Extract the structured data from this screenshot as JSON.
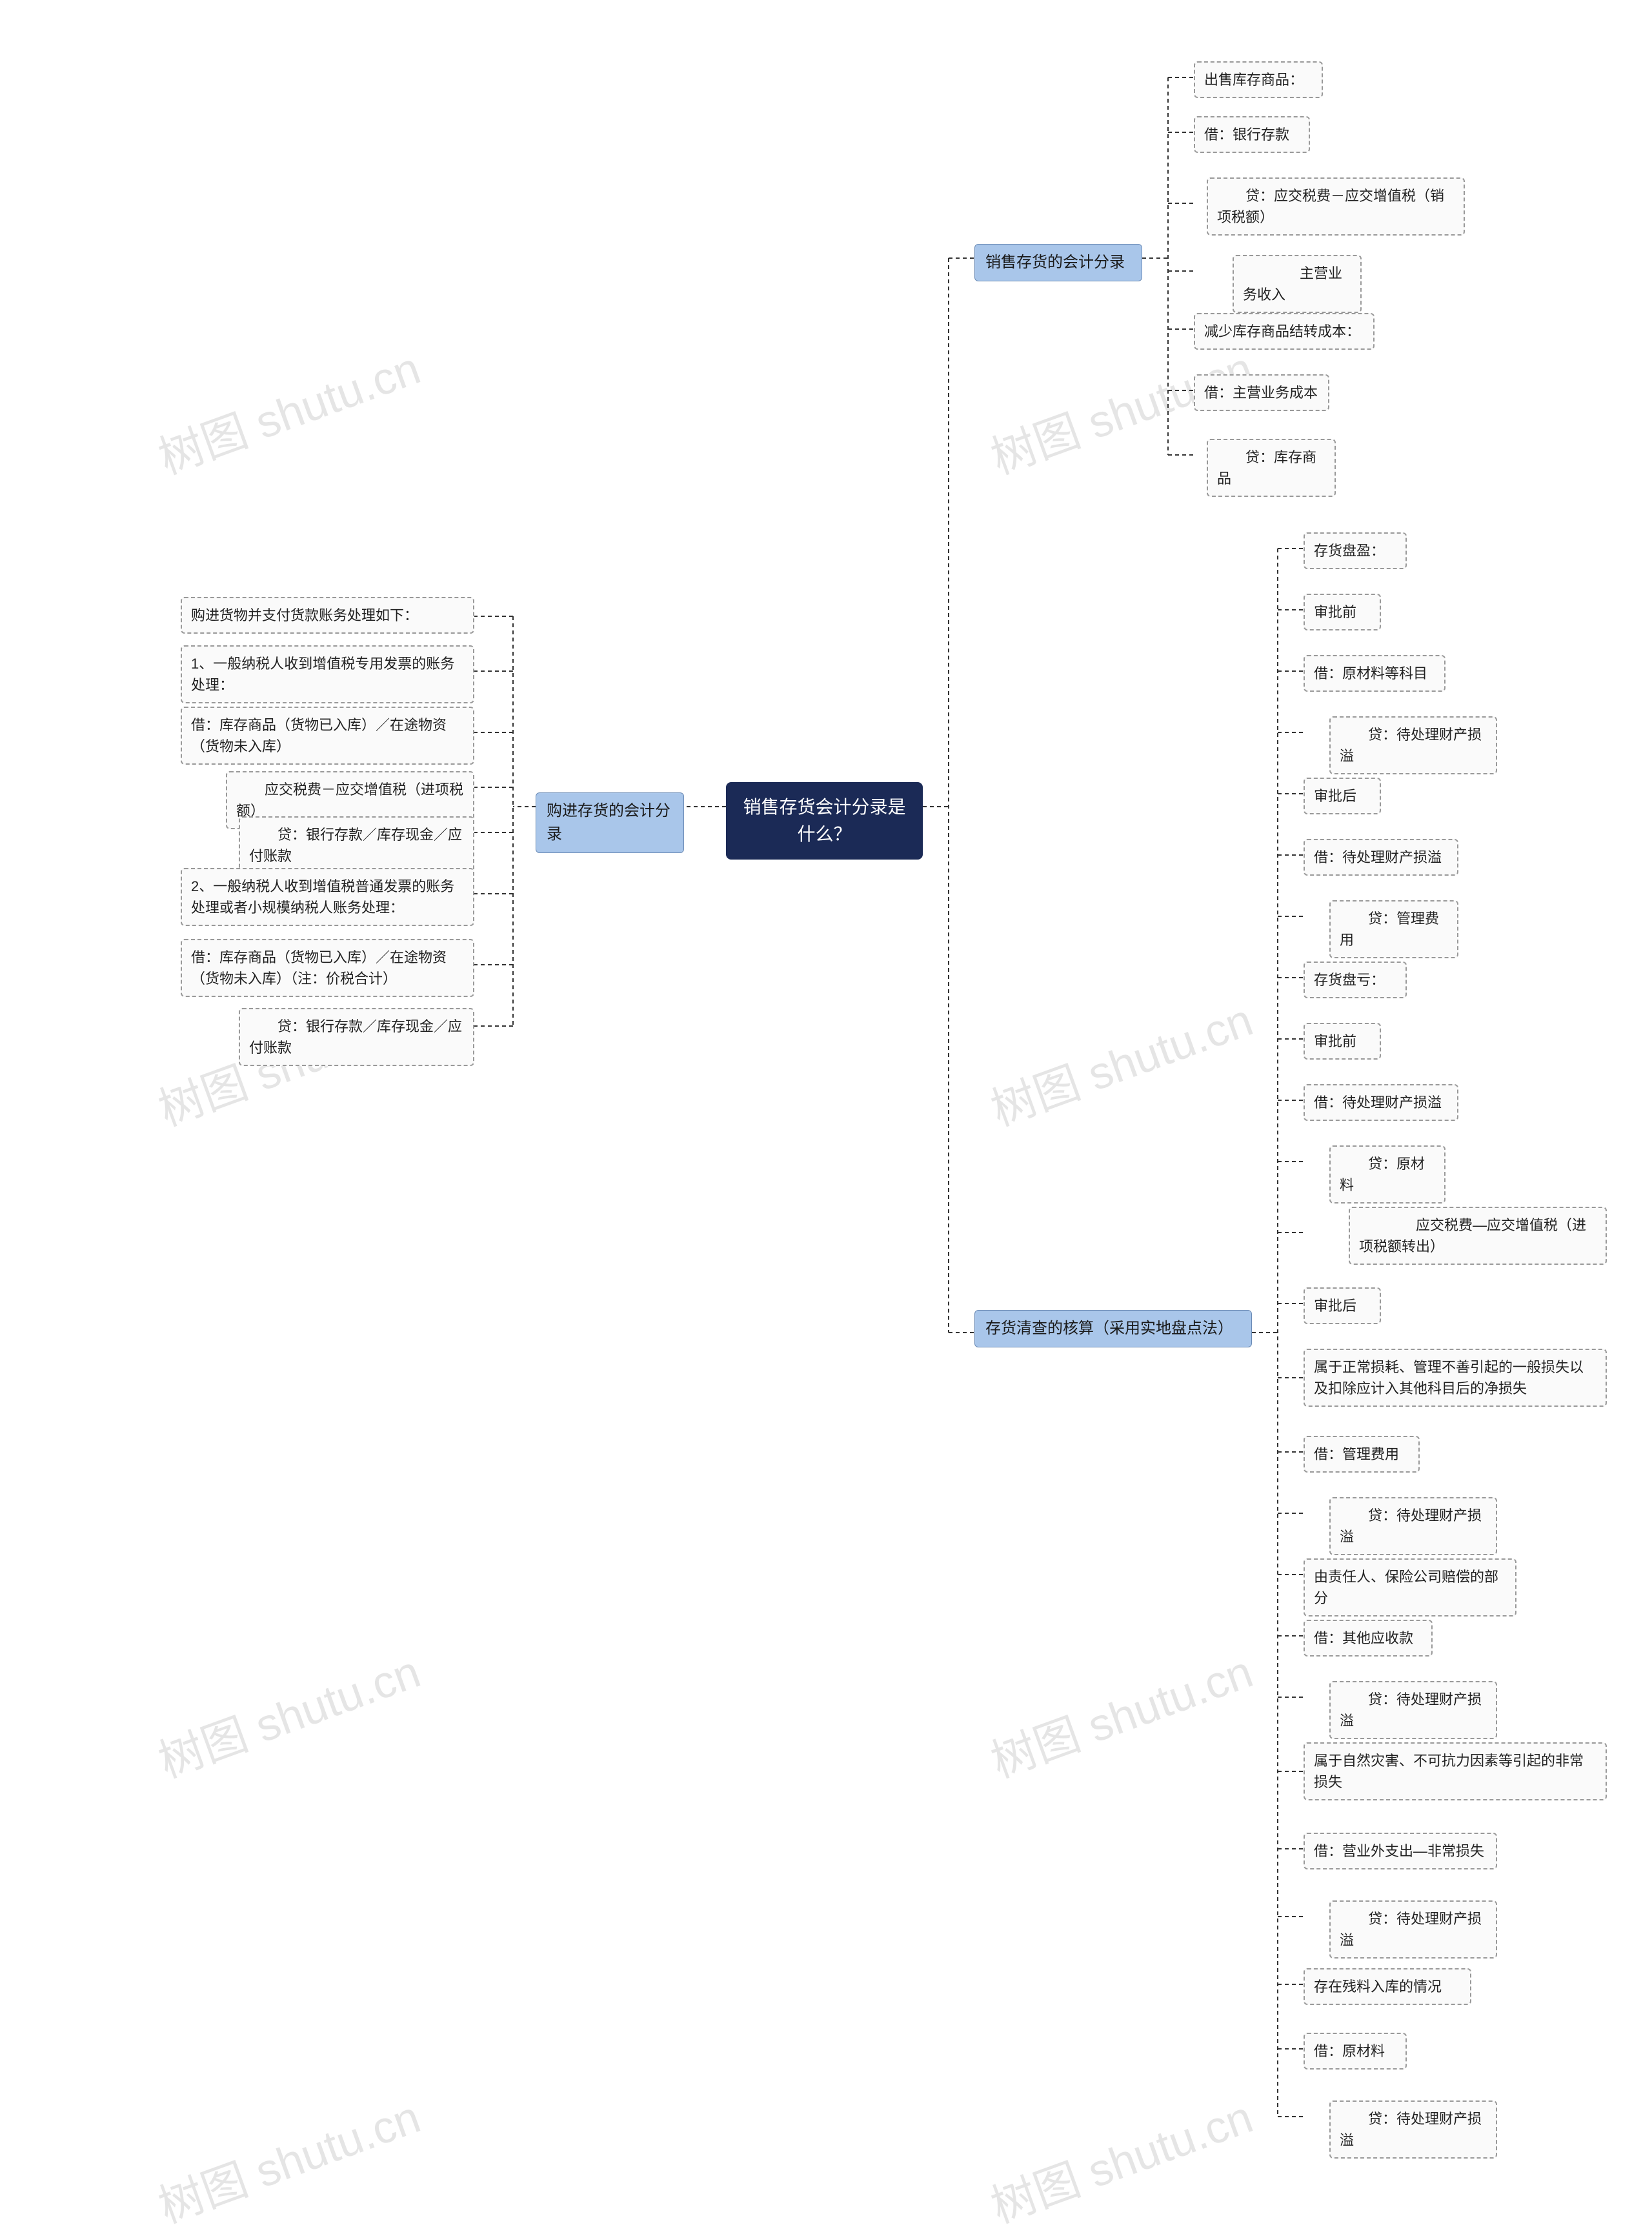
{
  "center": {
    "title": "销售存货会计分录是什么？"
  },
  "watermark": "树图 shutu.cn",
  "branches": {
    "left": {
      "label": "购进存货的会计分录"
    },
    "right1": {
      "label": "销售存货的会计分录"
    },
    "right2": {
      "label": "存货清查的核算（采用实地盘点法）"
    }
  },
  "leftLeaves": [
    "购进货物并支付货款账务处理如下：",
    "1、一般纳税人收到增值税专用发票的账务处理：",
    "借：库存商品（货物已入库）／在途物资（货物未入库）",
    "　　应交税费－应交增值税（进项税额）",
    "　　贷：银行存款／库存现金／应付账款",
    "2、一般纳税人收到增值税普通发票的账务处理或者小规模纳税人账务处理：",
    "借：库存商品（货物已入库）／在途物资（货物未入库）（注：价税合计）",
    "　　贷：银行存款／库存现金／应付账款"
  ],
  "right1Leaves": [
    "出售库存商品：",
    "借：银行存款",
    "　　贷：应交税费－应交增值税（销项税额）",
    "　　　　主营业务收入",
    "减少库存商品结转成本：",
    "借：主营业务成本",
    "　　贷：库存商品"
  ],
  "right2Leaves": [
    "存货盘盈：",
    "审批前",
    "借：原材料等科目",
    "　　贷：待处理财产损溢",
    "审批后",
    "借：待处理财产损溢",
    "　　贷：管理费用",
    "存货盘亏：",
    "审批前",
    "借：待处理财产损溢",
    "　　贷：原材料",
    "　　　　应交税费—应交增值税（进项税额转出）",
    "审批后",
    "属于正常损耗、管理不善引起的一般损失以及扣除应计入其他科目后的净损失",
    "借：管理费用",
    "　　贷：待处理财产损溢",
    "由责任人、保险公司赔偿的部分",
    "借：其他应收款",
    "　　贷：待处理财产损溢",
    "属于自然灾害、不可抗力因素等引起的非常损失",
    "借：营业外支出—非常损失",
    "　　贷：待处理财产损溢",
    "存在残料入库的情况",
    "借：原材料",
    "　　贷：待处理财产损溢"
  ]
}
